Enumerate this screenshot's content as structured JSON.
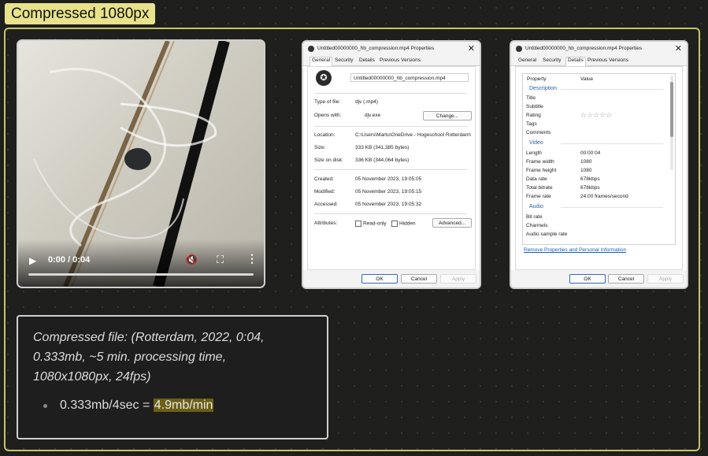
{
  "group_label": "Compressed 1080px",
  "video": {
    "time": "0:00 / 0:04",
    "progress": 0
  },
  "general_dialog": {
    "title": "Untitled00000000_hb_compression.mp4 Properties",
    "tabs": [
      "General",
      "Security",
      "Details",
      "Previous Versions"
    ],
    "active_tab": "General",
    "filename": "Untitled00000000_hb_compression.mp4",
    "fields": [
      {
        "key": "Type of file:",
        "value": "djv (.mp4)"
      },
      {
        "key": "Opens with:",
        "value": "djv.exe"
      },
      {
        "key": "Location:",
        "value": "C:\\Users\\Martu\\OneDrive - Hogeschool Rotterdam\\"
      },
      {
        "key": "Size:",
        "value": "333 KB (341,385 bytes)"
      },
      {
        "key": "Size on disk:",
        "value": "336 KB (344,064 bytes)"
      },
      {
        "key": "Created:",
        "value": "05 November 2023, 19:05:05"
      },
      {
        "key": "Modified:",
        "value": "05 November 2023, 19:05:15"
      },
      {
        "key": "Accessed:",
        "value": "05 November 2023, 19:05:32"
      },
      {
        "key": "Attributes:",
        "value": ""
      }
    ],
    "change_label": "Change...",
    "readonly_label": "Read-only",
    "hidden_label": "Hidden",
    "advanced_label": "Advanced...",
    "ok_label": "OK",
    "cancel_label": "Cancel",
    "apply_label": "Apply"
  },
  "details_dialog": {
    "title": "Untitled00000000_hb_compression.mp4 Properties",
    "tabs": [
      "General",
      "Security",
      "Details",
      "Previous Versions"
    ],
    "active_tab": "Details",
    "col_property": "Property",
    "col_value": "Value",
    "sections": {
      "description": "Description",
      "video": "Video",
      "audio": "Audio"
    },
    "description_rows": [
      {
        "key": "Title",
        "value": ""
      },
      {
        "key": "Subtitle",
        "value": ""
      },
      {
        "key": "Rating",
        "value": "☆☆☆☆☆"
      },
      {
        "key": "Tags",
        "value": ""
      },
      {
        "key": "Comments",
        "value": ""
      }
    ],
    "video_rows": [
      {
        "key": "Length",
        "value": "00:00:04"
      },
      {
        "key": "Frame width",
        "value": "1080"
      },
      {
        "key": "Frame height",
        "value": "1080"
      },
      {
        "key": "Data rate",
        "value": "678kbps"
      },
      {
        "key": "Total bitrate",
        "value": "678kbps"
      },
      {
        "key": "Frame rate",
        "value": "24.00 frames/second"
      }
    ],
    "audio_rows": [
      {
        "key": "Bit rate",
        "value": ""
      },
      {
        "key": "Channels",
        "value": ""
      },
      {
        "key": "Audio sample rate",
        "value": ""
      }
    ],
    "remove_link": "Remove Properties and Personal Information",
    "ok_label": "OK",
    "cancel_label": "Cancel",
    "apply_label": "Apply"
  },
  "note": {
    "text": "Compressed file: (Rotterdam, 2022, 0:04, 0.333mb, ~5 min. processing time, 1080x1080px, 24fps)",
    "bullet_prefix": "0.333mb/4sec = ",
    "bullet_highlight": "4.9mb/min"
  }
}
